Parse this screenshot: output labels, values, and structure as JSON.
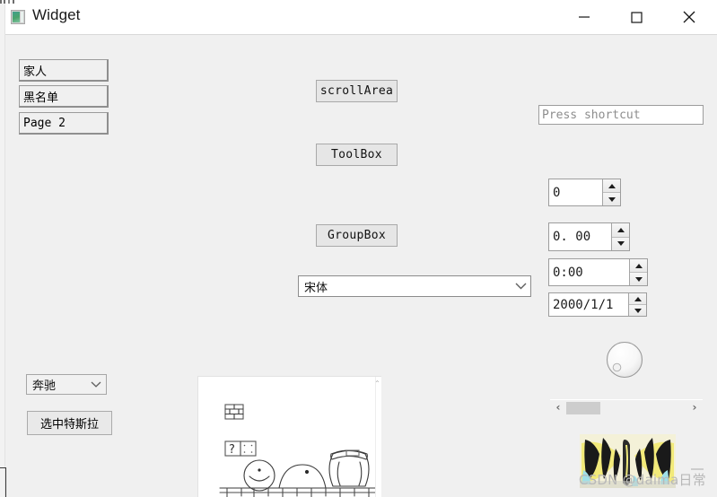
{
  "window": {
    "title": "Widget",
    "icon": "qt-logo-icon",
    "background": "#f0f0f0",
    "titlebar_background": "#ffffff",
    "controls": {
      "minimize": "—",
      "maximize": "□",
      "close": "✕"
    }
  },
  "left_panel": {
    "tab_buttons": [
      {
        "label": "家人",
        "script": "cjk"
      },
      {
        "label": "黑名单",
        "script": "cjk"
      },
      {
        "label": "Page 2",
        "script": "mono"
      }
    ],
    "car_combo": {
      "value": "奔驰",
      "chevron": "chevron-down-icon"
    },
    "tesla_button": {
      "label": "选中特斯拉"
    }
  },
  "center_panel": {
    "buttons": [
      {
        "label": "scrollArea"
      },
      {
        "label": "ToolBox"
      },
      {
        "label": "GroupBox"
      }
    ],
    "font_combo": {
      "value": "宋体",
      "chevron": "chevron-down-icon"
    }
  },
  "right_panel": {
    "key_sequence_edit": {
      "value": "",
      "placeholder": "Press shortcut",
      "placeholder_color": "#8d8d8d"
    },
    "spin_boxes": [
      {
        "name": "spin-box",
        "value": "0"
      },
      {
        "name": "double-spin-box",
        "value": "0. 00"
      },
      {
        "name": "time-edit",
        "value": "0:00"
      },
      {
        "name": "date-edit",
        "value": "2000/1/1"
      }
    ],
    "dial": {
      "name": "dial",
      "position": "lower-left"
    },
    "scrollbar": {
      "left_arrow": "‹",
      "right_arrow": "›",
      "handle_position": "near-left",
      "handle_color": "#cdcdcd"
    }
  },
  "scroll_area": {
    "name": "scroll-area-sketch",
    "content": "hand-drawn mario-style sketch: brick block, question block, round character face, a hill/blob with dot, and a large pot shape above a brick ground row",
    "scrollbar_arrow": "⌃"
  },
  "image_panel": {
    "name": "butterfly-image",
    "description": "yellow and black butterfly photo",
    "colors": {
      "wing": "#f2ea7a",
      "vein": "#191919",
      "accent": "#9fe0e8"
    }
  },
  "watermark": {
    "text": "CSDN @daima日常",
    "color": "#b8b8b8"
  }
}
